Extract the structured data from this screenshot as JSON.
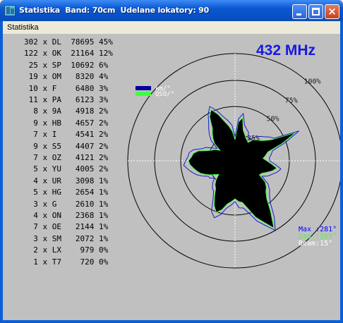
{
  "window": {
    "title": "Statistika  Band: 70cm  Udelane lokatory: 90",
    "close_glyph": "×"
  },
  "menu": {
    "item": "Statistika"
  },
  "frequency": "432 MHz",
  "stats": [
    {
      "count": "302",
      "prefix": "DL",
      "value": "78695",
      "pct": "45%"
    },
    {
      "count": "122",
      "prefix": "OK",
      "value": "21164",
      "pct": "12%"
    },
    {
      "count": "25",
      "prefix": "SP",
      "value": "10692",
      "pct": "6%"
    },
    {
      "count": "19",
      "prefix": "OM",
      "value": "8320",
      "pct": "4%"
    },
    {
      "count": "10",
      "prefix": "F",
      "value": "6480",
      "pct": "3%"
    },
    {
      "count": "11",
      "prefix": "PA",
      "value": "6123",
      "pct": "3%"
    },
    {
      "count": "8",
      "prefix": "9A",
      "value": "4918",
      "pct": "2%"
    },
    {
      "count": "9",
      "prefix": "HB",
      "value": "4657",
      "pct": "2%"
    },
    {
      "count": "7",
      "prefix": "I",
      "value": "4541",
      "pct": "2%"
    },
    {
      "count": "9",
      "prefix": "S5",
      "value": "4407",
      "pct": "2%"
    },
    {
      "count": "7",
      "prefix": "OZ",
      "value": "4121",
      "pct": "2%"
    },
    {
      "count": "5",
      "prefix": "YU",
      "value": "4005",
      "pct": "2%"
    },
    {
      "count": "4",
      "prefix": "UR",
      "value": "3098",
      "pct": "1%"
    },
    {
      "count": "5",
      "prefix": "HG",
      "value": "2654",
      "pct": "1%"
    },
    {
      "count": "3",
      "prefix": "G",
      "value": "2610",
      "pct": "1%"
    },
    {
      "count": "4",
      "prefix": "ON",
      "value": "2368",
      "pct": "1%"
    },
    {
      "count": "7",
      "prefix": "OE",
      "value": "2144",
      "pct": "1%"
    },
    {
      "count": "3",
      "prefix": "SM",
      "value": "2072",
      "pct": "1%"
    },
    {
      "count": "2",
      "prefix": "LX",
      "value": "979",
      "pct": "0%"
    },
    {
      "count": "1",
      "prefix": "T7",
      "value": "720",
      "pct": "0%"
    }
  ],
  "chart_data": {
    "type": "polar",
    "legend": [
      {
        "label": "km/°",
        "color": "#0000a0"
      },
      {
        "label": "QSO/°",
        "color": "#40ff40"
      }
    ],
    "ring_labels": [
      "25%",
      "50%",
      "75%",
      "100%"
    ],
    "max_label": "Max :281°",
    "qso_label": "Qso :265°",
    "beam_label": "Beam:15°",
    "colors": {
      "max": "#0000ff",
      "qso": "#40ff40",
      "beam": "#ffffff",
      "km_line": "#1a1ad0",
      "fill": "#000000"
    }
  }
}
